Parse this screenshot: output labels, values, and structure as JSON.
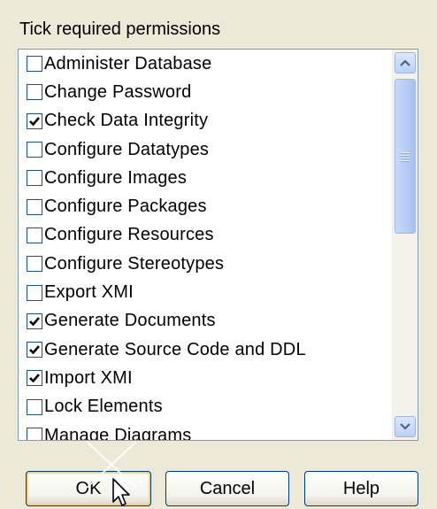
{
  "heading": "Tick required permissions",
  "permissions": [
    {
      "label": "Administer Database",
      "checked": false
    },
    {
      "label": "Change Password",
      "checked": false
    },
    {
      "label": "Check Data Integrity",
      "checked": true
    },
    {
      "label": "Configure Datatypes",
      "checked": false
    },
    {
      "label": "Configure Images",
      "checked": false
    },
    {
      "label": "Configure Packages",
      "checked": false
    },
    {
      "label": "Configure Resources",
      "checked": false
    },
    {
      "label": "Configure Stereotypes",
      "checked": false
    },
    {
      "label": "Export XMI",
      "checked": false
    },
    {
      "label": "Generate Documents",
      "checked": true
    },
    {
      "label": "Generate Source Code and DDL",
      "checked": true
    },
    {
      "label": "Import XMI",
      "checked": true
    },
    {
      "label": "Lock Elements",
      "checked": false
    },
    {
      "label": "Manage Diagrams",
      "checked": false
    }
  ],
  "buttons": {
    "ok": "OK",
    "cancel": "Cancel",
    "help": "Help"
  },
  "icons": {
    "scroll_up": "arrow-up-icon",
    "scroll_down": "arrow-down-icon",
    "checkmark": "checkmark-icon",
    "cursor": "mouse-pointer-icon"
  },
  "colors": {
    "dialog_bg": "#ece9d8",
    "list_border": "#7f9db9",
    "scrollbar_accent": "#bcd0f7",
    "button_border": "#003c74"
  }
}
